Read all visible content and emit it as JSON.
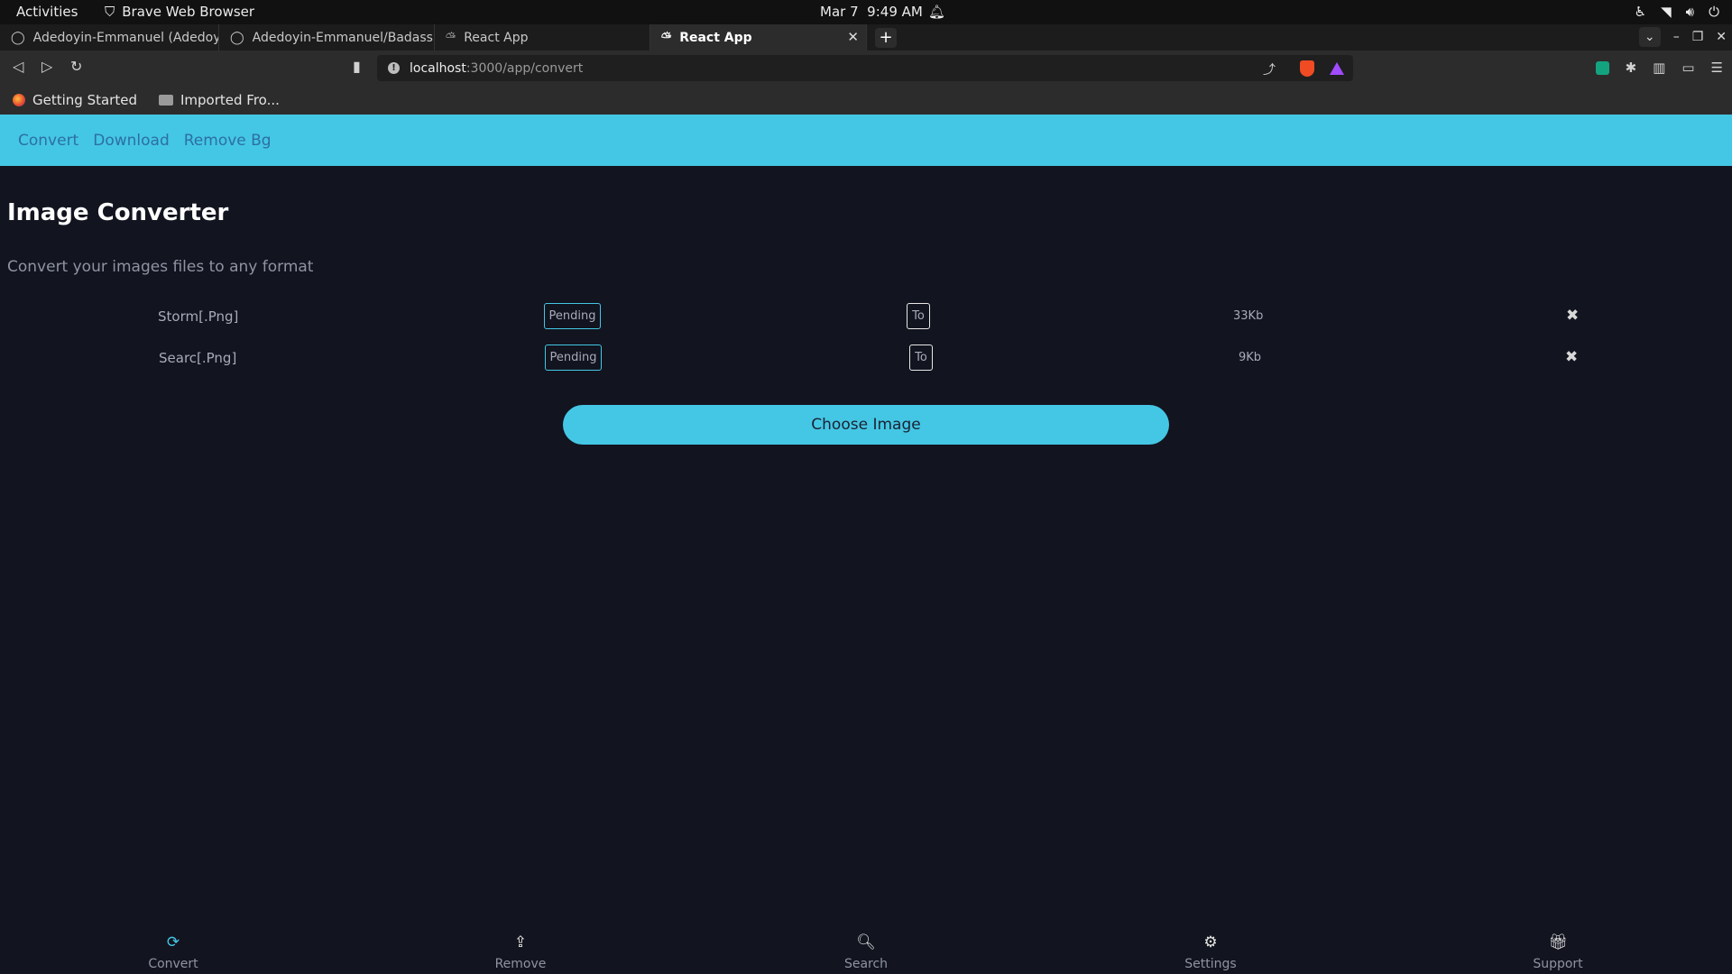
{
  "os_bar": {
    "activities": "Activities",
    "app_name": "Brave Web Browser",
    "date": "Mar 7",
    "time": "9:49 AM"
  },
  "tabs": [
    {
      "label": "Adedoyin-Emmanuel (Adedoy",
      "active": false
    },
    {
      "label": "Adedoyin-Emmanuel/Badass",
      "active": false
    },
    {
      "label": "React App",
      "active": false
    },
    {
      "label": "React App",
      "active": true
    }
  ],
  "address": {
    "host": "localhost",
    "path": ":3000/app/convert"
  },
  "bookmarks": [
    {
      "label": "Getting Started",
      "icon": "firefox-icon"
    },
    {
      "label": "Imported Fro...",
      "icon": "folder-icon"
    }
  ],
  "app_nav": {
    "convert": "Convert",
    "download": "Download",
    "remove_bg": "Remove Bg"
  },
  "main": {
    "title": "Image Converter",
    "subtitle": "Convert your images files to any format",
    "choose_button": "Choose Image"
  },
  "files": [
    {
      "name": "Storm[.Png]",
      "status": "Pending",
      "to_label": "To",
      "size": "33Kb"
    },
    {
      "name": "Searc[.Png]",
      "status": "Pending",
      "to_label": "To",
      "size": "9Kb"
    }
  ],
  "bottom_nav": [
    {
      "label": "Convert",
      "icon": "refresh-icon",
      "active": true
    },
    {
      "label": "Remove",
      "icon": "upload-icon",
      "active": false
    },
    {
      "label": "Search",
      "icon": "search-icon",
      "active": false
    },
    {
      "label": "Settings",
      "icon": "gear-icon",
      "active": false
    },
    {
      "label": "Support",
      "icon": "gift-icon",
      "active": false
    }
  ],
  "colors": {
    "accent": "#44c7e4",
    "background": "#12141f",
    "nav_link": "#2c6fa3"
  }
}
